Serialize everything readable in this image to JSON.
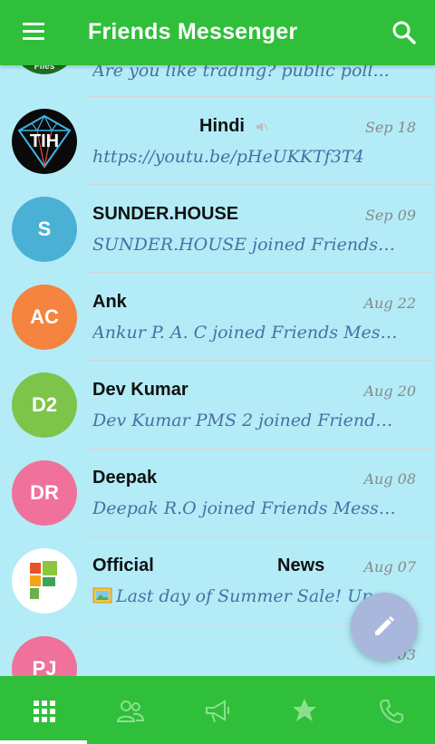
{
  "app": {
    "title": "Friends Messenger"
  },
  "colors": {
    "primary": "#2fbf3a",
    "background": "#b3ecf7",
    "fab": "#a9b7dd"
  },
  "icons": {
    "menu": "menu-icon",
    "search": "search-icon",
    "compose": "pencil-icon",
    "tabs": [
      "grid-icon",
      "contacts-icon",
      "megaphone-icon",
      "star-icon",
      "phone-icon"
    ]
  },
  "chats": [
    {
      "avatar": "Files",
      "name": "",
      "date": "",
      "message": "Are you like trading? public poll..."
    },
    {
      "avatar": "TIH",
      "name": "Hindi",
      "muted": true,
      "date": "Sep 18",
      "message": "https://youtu.be/pHeUKKTf3T4"
    },
    {
      "avatar": "S",
      "name": "SUNDER.HOUSE",
      "date": "Sep 09",
      "message": "SUNDER.HOUSE joined Friends Me..."
    },
    {
      "avatar": "AC",
      "name": "Ank",
      "date": "Aug 22",
      "message": "Ankur P. A. C joined Friends Mess..."
    },
    {
      "avatar": "D2",
      "name": "Dev Kumar",
      "date": "Aug 20",
      "message": "Dev Kumar PMS 2 joined Friends..."
    },
    {
      "avatar": "DR",
      "name": "Deepak",
      "date": "Aug 08",
      "message": "Deepak R.O joined Friends Messe..."
    },
    {
      "avatar": "",
      "name": "Official",
      "name_suffix": "News",
      "date": "Aug 07",
      "message": "Last day of Summer Sale! Up..."
    },
    {
      "avatar": "PJ",
      "name": "",
      "date": "03",
      "message": ""
    }
  ]
}
